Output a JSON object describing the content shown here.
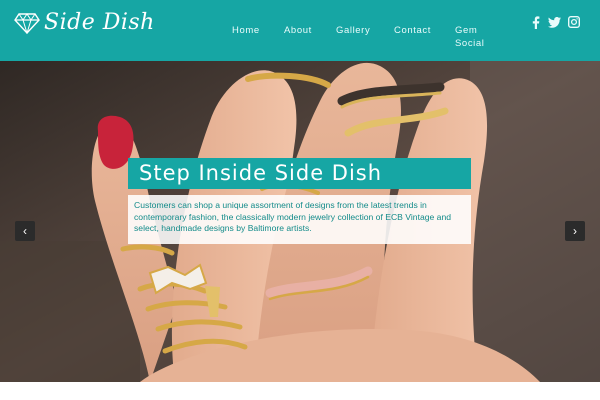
{
  "brand": {
    "name": "Side Dish",
    "logo_icon": "diamond-icon"
  },
  "nav": {
    "items": [
      {
        "label": "Home"
      },
      {
        "label": "About"
      },
      {
        "label": "Gallery"
      },
      {
        "label": "Contact"
      },
      {
        "label": "Gem Social"
      }
    ]
  },
  "social": {
    "icons": [
      "facebook-icon",
      "twitter-icon",
      "instagram-icon"
    ]
  },
  "hero": {
    "title": "Step Inside Side Dish",
    "body": "Customers can shop a unique assortment of designs from the latest trends in contemporary fashion, the classically modern jewelry collection of ECB Vintage and select, handmade designs by Baltimore artists.",
    "prev_symbol": "‹",
    "next_symbol": "›"
  },
  "colors": {
    "accent": "#16a6a4",
    "caption_text": "#138b8a"
  }
}
